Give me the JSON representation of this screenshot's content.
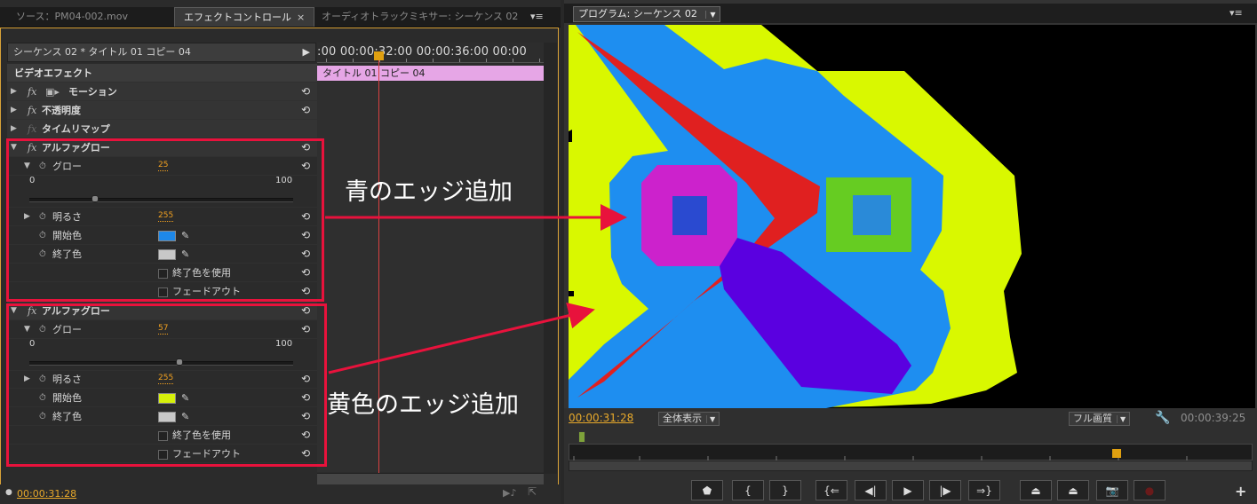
{
  "left_panel": {
    "tabs": [
      {
        "label": "ソース：PM04-002.mov"
      },
      {
        "label": "エフェクトコントロール"
      },
      {
        "label": "オーディオトラックミキサー: シーケンス 02"
      }
    ],
    "close_glyph": "×",
    "sequence_header": "シーケンス 02 * タイトル 01 コピー 04",
    "ruler_timecodes": ":00 00:00:32:00 00:00:36:00 00:00",
    "clip_label": "タイトル 01 コピー 04",
    "video_effects_label": "ビデオエフェクト",
    "effects": [
      {
        "label": "モーション"
      },
      {
        "label": "不透明度"
      },
      {
        "label": "タイムリマップ"
      }
    ],
    "alpha_glows": [
      {
        "title": "アルファグロー",
        "glow_label": "グロー",
        "glow_value": "25",
        "slider_min": "0",
        "slider_max": "100",
        "slider_level": 0.25,
        "brightness_label": "明るさ",
        "brightness_value": "255",
        "start_color_label": "開始色",
        "start_color": "#1e88e8",
        "end_color_label": "終了色",
        "end_color": "#c8c8c8",
        "use_end_color_label": "終了色を使用",
        "fade_out_label": "フェードアウト"
      },
      {
        "title": "アルファグロー",
        "glow_label": "グロー",
        "glow_value": "57",
        "slider_min": "0",
        "slider_max": "100",
        "slider_level": 0.57,
        "brightness_label": "明るさ",
        "brightness_value": "255",
        "start_color_label": "開始色",
        "start_color": "#d6f00a",
        "end_color_label": "終了色",
        "end_color": "#c8c8c8",
        "use_end_color_label": "終了色を使用",
        "fade_out_label": "フェードアウト"
      }
    ],
    "footer_timecode": "00:00:31:28"
  },
  "right_panel": {
    "tab_label": "プログラム: シーケンス 02",
    "timecode_current": "00:00:31:28",
    "zoom_dropdown": "全体表示",
    "quality_dropdown": "フル画質",
    "timecode_duration": "00:00:39:25",
    "transport_buttons": [
      "marker",
      "mark-in",
      "mark-out",
      "go-to-in",
      "step-back",
      "play",
      "step-forward",
      "go-to-out",
      "lift",
      "extract",
      "export-frame",
      "record"
    ]
  },
  "annotations": {
    "blue_edge": "青のエッジ追加",
    "yellow_edge": "黄色のエッジ追加"
  },
  "colors": {
    "accent_orange": "#e8a92b",
    "annotation_red": "#e8123c",
    "frame_yellow": "#d9f800",
    "frame_blue": "#1e8ef0",
    "frame_red": "#e02020",
    "frame_magenta": "#cc22cc",
    "frame_green": "#66cc22",
    "frame_purple": "#5a00e0"
  }
}
